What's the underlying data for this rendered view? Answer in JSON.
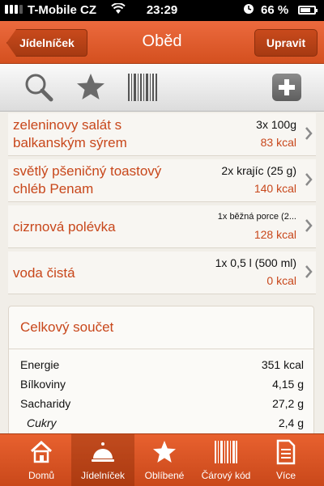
{
  "status": {
    "carrier": "T-Mobile CZ",
    "time": "23:29",
    "battery": "66 %"
  },
  "nav": {
    "back_label": "Jídelníček",
    "title": "Oběd",
    "edit_label": "Upravit"
  },
  "toolbar": {
    "icons": [
      "search-icon",
      "star-icon",
      "barcode-icon",
      "plus-icon"
    ]
  },
  "items": [
    {
      "name": "zeleninovy salát s balkanským sýrem",
      "qty": "3x 100g",
      "kcal": "83 kcal"
    },
    {
      "name": "světlý pšeničný toastový chléb Penam",
      "qty": "2x krajíc (25 g)",
      "kcal": "140 kcal"
    },
    {
      "name": "cizrnová polévka",
      "qty": "1x běžná porce (2...",
      "kcal": "128 kcal"
    },
    {
      "name": "voda čistá",
      "qty": "1x 0,5 l (500 ml)",
      "kcal": "0 kcal"
    }
  ],
  "summary": {
    "title": "Celkový součet",
    "rows": [
      {
        "label": "Energie",
        "value": "351 kcal"
      },
      {
        "label": "Bílkoviny",
        "value": "4,15 g"
      },
      {
        "label": "Sacharidy",
        "value": "27,2 g"
      },
      {
        "label": "Cukry",
        "value": "2,4 g"
      }
    ]
  },
  "tabs": [
    {
      "label": "Domů"
    },
    {
      "label": "Jídelníček"
    },
    {
      "label": "Oblíbené"
    },
    {
      "label": "Čárový kód"
    },
    {
      "label": "Více"
    }
  ],
  "colors": {
    "accent": "#d4501f",
    "text_accent": "#c8471b"
  }
}
